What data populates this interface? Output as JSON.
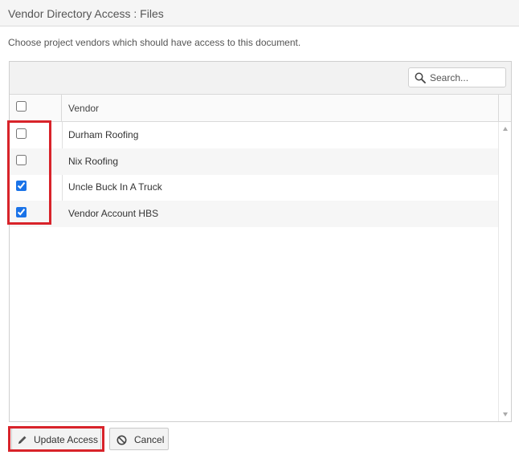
{
  "dialog": {
    "title": "Vendor Directory Access : Files",
    "subtitle": "Choose project vendors which should have access to this document."
  },
  "search": {
    "placeholder": "Search..."
  },
  "table": {
    "columns": [
      "",
      "Vendor"
    ],
    "rows": [
      {
        "vendor": "Durham Roofing",
        "checked": false
      },
      {
        "vendor": "Nix Roofing",
        "checked": false
      },
      {
        "vendor": "Uncle Buck In A Truck",
        "checked": true
      },
      {
        "vendor": "Vendor Account HBS",
        "checked": true
      }
    ]
  },
  "buttons": {
    "update_label": "Update Access",
    "cancel_label": "Cancel"
  },
  "colors": {
    "highlight": "#d8232a",
    "checkbox_accent": "#1a73e8"
  },
  "icons": {
    "search": "search-icon",
    "update": "pencil-icon",
    "cancel": "ban-icon"
  }
}
